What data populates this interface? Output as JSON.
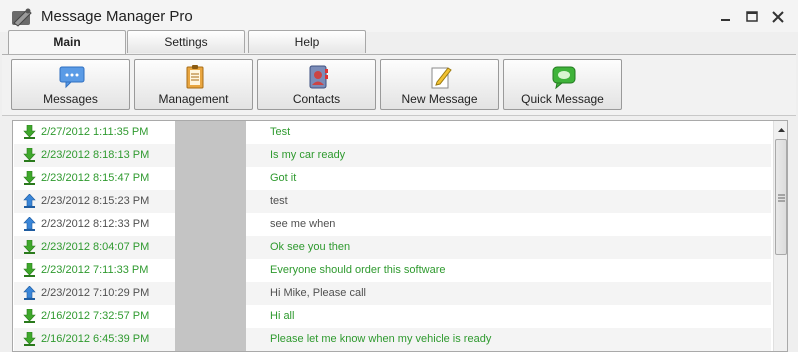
{
  "window": {
    "title": "Message Manager Pro"
  },
  "tabs": [
    {
      "label": "Main",
      "active": true
    },
    {
      "label": "Settings",
      "active": false
    },
    {
      "label": "Help",
      "active": false
    }
  ],
  "toolbar": {
    "buttons": [
      {
        "label": "Messages",
        "icon": "speech-bubble-icon"
      },
      {
        "label": "Management",
        "icon": "clipboard-icon"
      },
      {
        "label": "Contacts",
        "icon": "address-book-icon"
      },
      {
        "label": "New Message",
        "icon": "pencil-note-icon"
      },
      {
        "label": "Quick Message",
        "icon": "green-chat-icon"
      }
    ]
  },
  "colors": {
    "incoming_text": "#2f9a2f",
    "outgoing_text": "#505050",
    "incoming_arrow": "#3fa82c",
    "outgoing_arrow": "#3a86d8"
  },
  "messages": [
    {
      "direction": "incoming",
      "date": "2/27/2012 1:11:35 PM",
      "text": "Test"
    },
    {
      "direction": "incoming",
      "date": "2/23/2012 8:18:13 PM",
      "text": "Is my car ready"
    },
    {
      "direction": "incoming",
      "date": "2/23/2012 8:15:47 PM",
      "text": "Got it"
    },
    {
      "direction": "outgoing",
      "date": "2/23/2012 8:15:23 PM",
      "text": "test"
    },
    {
      "direction": "outgoing",
      "date": "2/23/2012 8:12:33 PM",
      "text": "see me when"
    },
    {
      "direction": "incoming",
      "date": "2/23/2012 8:04:07 PM",
      "text": "Ok see you then"
    },
    {
      "direction": "incoming",
      "date": "2/23/2012 7:11:33 PM",
      "text": "Everyone should order this software"
    },
    {
      "direction": "outgoing",
      "date": "2/23/2012 7:10:29 PM",
      "text": "Hi Mike, Please call"
    },
    {
      "direction": "incoming",
      "date": "2/16/2012 7:32:57 PM",
      "text": "Hi all"
    },
    {
      "direction": "incoming",
      "date": "2/16/2012 6:45:39 PM",
      "text": "Please let me know when my vehicle is ready"
    }
  ]
}
